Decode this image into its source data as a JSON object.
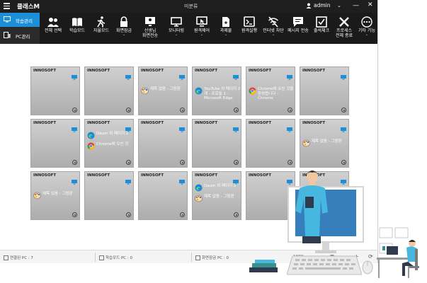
{
  "titlebar": {
    "app_title": "클래스M",
    "window_title": "미분류",
    "user_name": "admin"
  },
  "sidebar": {
    "items": [
      {
        "label": "학습관리",
        "icon": "monitor-icon",
        "active": true
      },
      {
        "label": "PC관리",
        "icon": "pc-icon",
        "active": false
      }
    ]
  },
  "toolbar": {
    "items": [
      {
        "line1": "전체 선택",
        "line2": "",
        "icon": "users-icon",
        "dropdown": false
      },
      {
        "line1": "학습모드",
        "line2": "",
        "icon": "book-icon",
        "dropdown": false
      },
      {
        "line1": "자율모드",
        "line2": "",
        "icon": "walk-icon",
        "dropdown": false
      },
      {
        "line1": "화면잠금",
        "line2": "",
        "icon": "lock-icon",
        "dropdown": true
      },
      {
        "line1": "선생님",
        "line2": "화면전송",
        "icon": "teacher-screen-icon",
        "dropdown": false
      },
      {
        "line1": "모니터링",
        "line2": "",
        "icon": "monitor-icon",
        "dropdown": true
      },
      {
        "line1": "원격제어",
        "line2": "",
        "icon": "remote-icon",
        "dropdown": true
      },
      {
        "line1": "과제물",
        "line2": "",
        "icon": "file-icon",
        "dropdown": true
      },
      {
        "line1": "원격실행",
        "line2": "",
        "icon": "terminal-icon",
        "dropdown": false
      },
      {
        "line1": "인터넷 차단",
        "line2": "",
        "icon": "no-wifi-icon",
        "dropdown": true
      },
      {
        "line1": "메시지 전송",
        "line2": "",
        "icon": "message-icon",
        "dropdown": false
      },
      {
        "line1": "출석체크",
        "line2": "",
        "icon": "check-icon",
        "dropdown": false
      },
      {
        "line1": "프로세스",
        "line2": "전체 종료",
        "icon": "tools-icon",
        "dropdown": false
      },
      {
        "line1": "기타 기능",
        "line2": "",
        "icon": "more-icon",
        "dropdown": true
      }
    ]
  },
  "tiles": [
    {
      "name": "INNOSOFT",
      "apps": []
    },
    {
      "name": "INNOSOFT",
      "apps": []
    },
    {
      "name": "INNOSOFT",
      "apps": [
        {
          "icon": "paint-icon",
          "text": "제목 없음 - 그림판"
        }
      ]
    },
    {
      "name": "INNOSOFT",
      "apps": [
        {
          "icon": "edge-icon",
          "text": "YouTube 외 페이지 2개 - 프로필 1 - Microsoft Edge"
        }
      ]
    },
    {
      "name": "INNOSOFT",
      "apps": [
        {
          "icon": "chrome-icon",
          "text": "Chrome에 오신 것을 환영합니다 - Chrome"
        }
      ]
    },
    {
      "name": "INNOSOFT",
      "apps": []
    },
    {
      "name": "INNOSOFT",
      "apps": []
    },
    {
      "name": "INNOSOFT",
      "apps": [
        {
          "icon": "edge-icon",
          "text": "Daum 외 페이지 2"
        },
        {
          "icon": "chrome-icon",
          "text": "Chrome에 오신 것"
        }
      ]
    },
    {
      "name": "INNOSOFT",
      "apps": []
    },
    {
      "name": "INNOSOFT",
      "apps": []
    },
    {
      "name": "INNOSOFT",
      "apps": []
    },
    {
      "name": "INNOSOFT",
      "apps": [
        {
          "icon": "paint-icon",
          "text": "제목 없음 - 그림판"
        }
      ]
    },
    {
      "name": "INNOSOFT",
      "apps": [
        {
          "icon": "paint-icon",
          "text": "제목 없음 - 그림판"
        }
      ]
    },
    {
      "name": "INNOSOFT",
      "apps": []
    },
    {
      "name": "INNOSOFT",
      "apps": []
    },
    {
      "name": "INNOSOFT",
      "apps": [
        {
          "icon": "edge-icon",
          "text": "Daum 외 페이지 2"
        },
        {
          "icon": "paint-icon",
          "text": "제목 없음 - 그림판"
        }
      ]
    },
    {
      "name": "INNOSOFT",
      "apps": []
    },
    {
      "name": "INNOSOFT",
      "apps": []
    }
  ],
  "statusbar": {
    "connected": "연결된 PC : 7",
    "study_mode": "학습모드 PC : 0",
    "screen_lock": "화면잠금 PC : 0",
    "zoom": "100%"
  },
  "colors": {
    "accent": "#1b8fd8",
    "toolbar_bg": "#1a1a1a",
    "titlebar_bg": "#1e1e1e"
  }
}
